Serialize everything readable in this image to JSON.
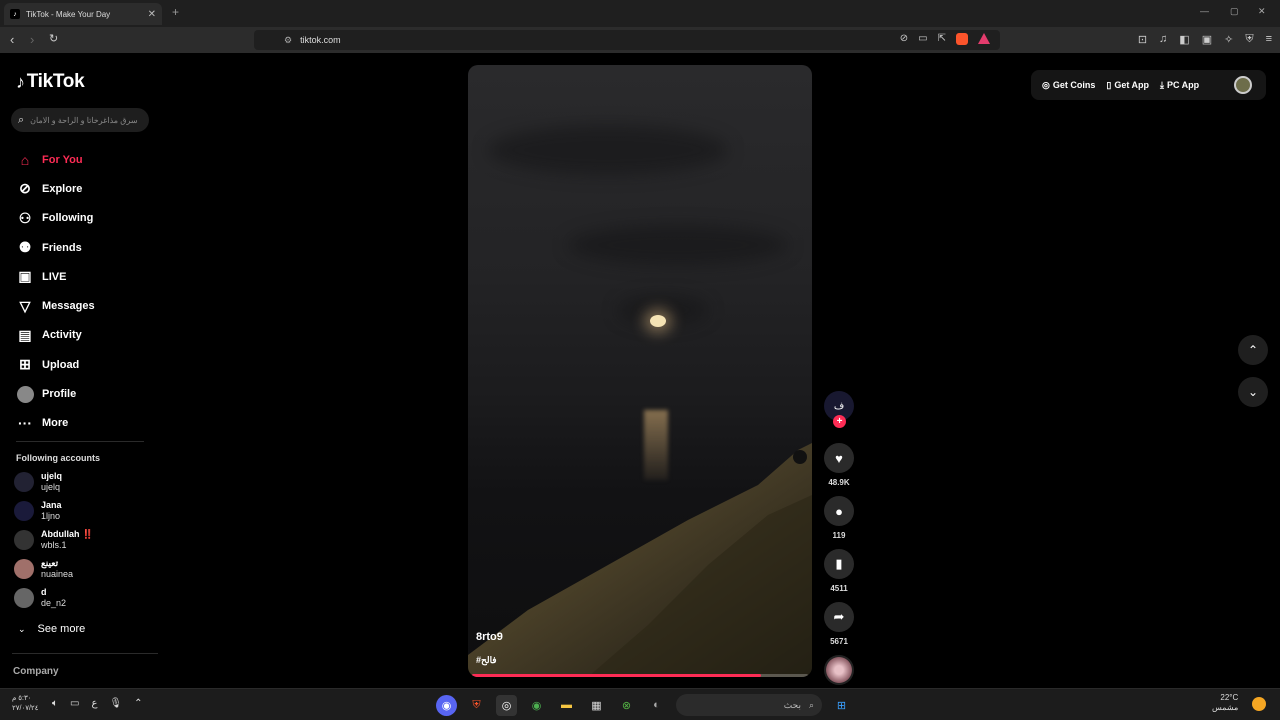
{
  "browser": {
    "tab_title": "TikTok - Make Your Day",
    "url": "tiktok.com"
  },
  "sidebar": {
    "logo": "TikTok",
    "search_placeholder": "سرق مذاغرخاتا و الراحة و الامان",
    "nav": [
      {
        "label": "For You",
        "icon": "home-icon",
        "active": true
      },
      {
        "label": "Explore",
        "icon": "compass-icon"
      },
      {
        "label": "Following",
        "icon": "following-icon"
      },
      {
        "label": "Friends",
        "icon": "friends-icon"
      },
      {
        "label": "LIVE",
        "icon": "live-icon"
      },
      {
        "label": "Messages",
        "icon": "messages-icon"
      },
      {
        "label": "Activity",
        "icon": "activity-icon"
      },
      {
        "label": "Upload",
        "icon": "upload-icon"
      },
      {
        "label": "Profile",
        "icon": "profile-avatar"
      },
      {
        "label": "More",
        "icon": "more-icon"
      }
    ],
    "following_header": "Following accounts",
    "accounts": [
      {
        "name": "ujelq",
        "username": "ujelq"
      },
      {
        "name": "Jana",
        "username": "1ljno"
      },
      {
        "name": "Abdullah ‼️",
        "username": "wbls.1"
      },
      {
        "name": "تعينع",
        "username": "nuainea"
      },
      {
        "name": "d",
        "username": "de_n2"
      }
    ],
    "see_more": "See more",
    "company": "Company"
  },
  "video": {
    "username": "8rto9",
    "hashtag": "#فالح",
    "progress": 0.86
  },
  "actions": {
    "creator_initial": "ف",
    "likes": "48.9K",
    "comments": "119",
    "saves": "4511",
    "shares": "5671"
  },
  "header": {
    "get_coins": "Get Coins",
    "get_app": "Get App",
    "pc_app": "PC App"
  },
  "taskbar": {
    "time": "٥:٣٠ م",
    "date": "٢٧/٠٧/٢٤",
    "search": "بحث",
    "weather_temp": "22°C",
    "weather_desc": "مشمس",
    "lang": "ع"
  },
  "colors": {
    "accent": "#fe2c55",
    "background": "#000000"
  }
}
